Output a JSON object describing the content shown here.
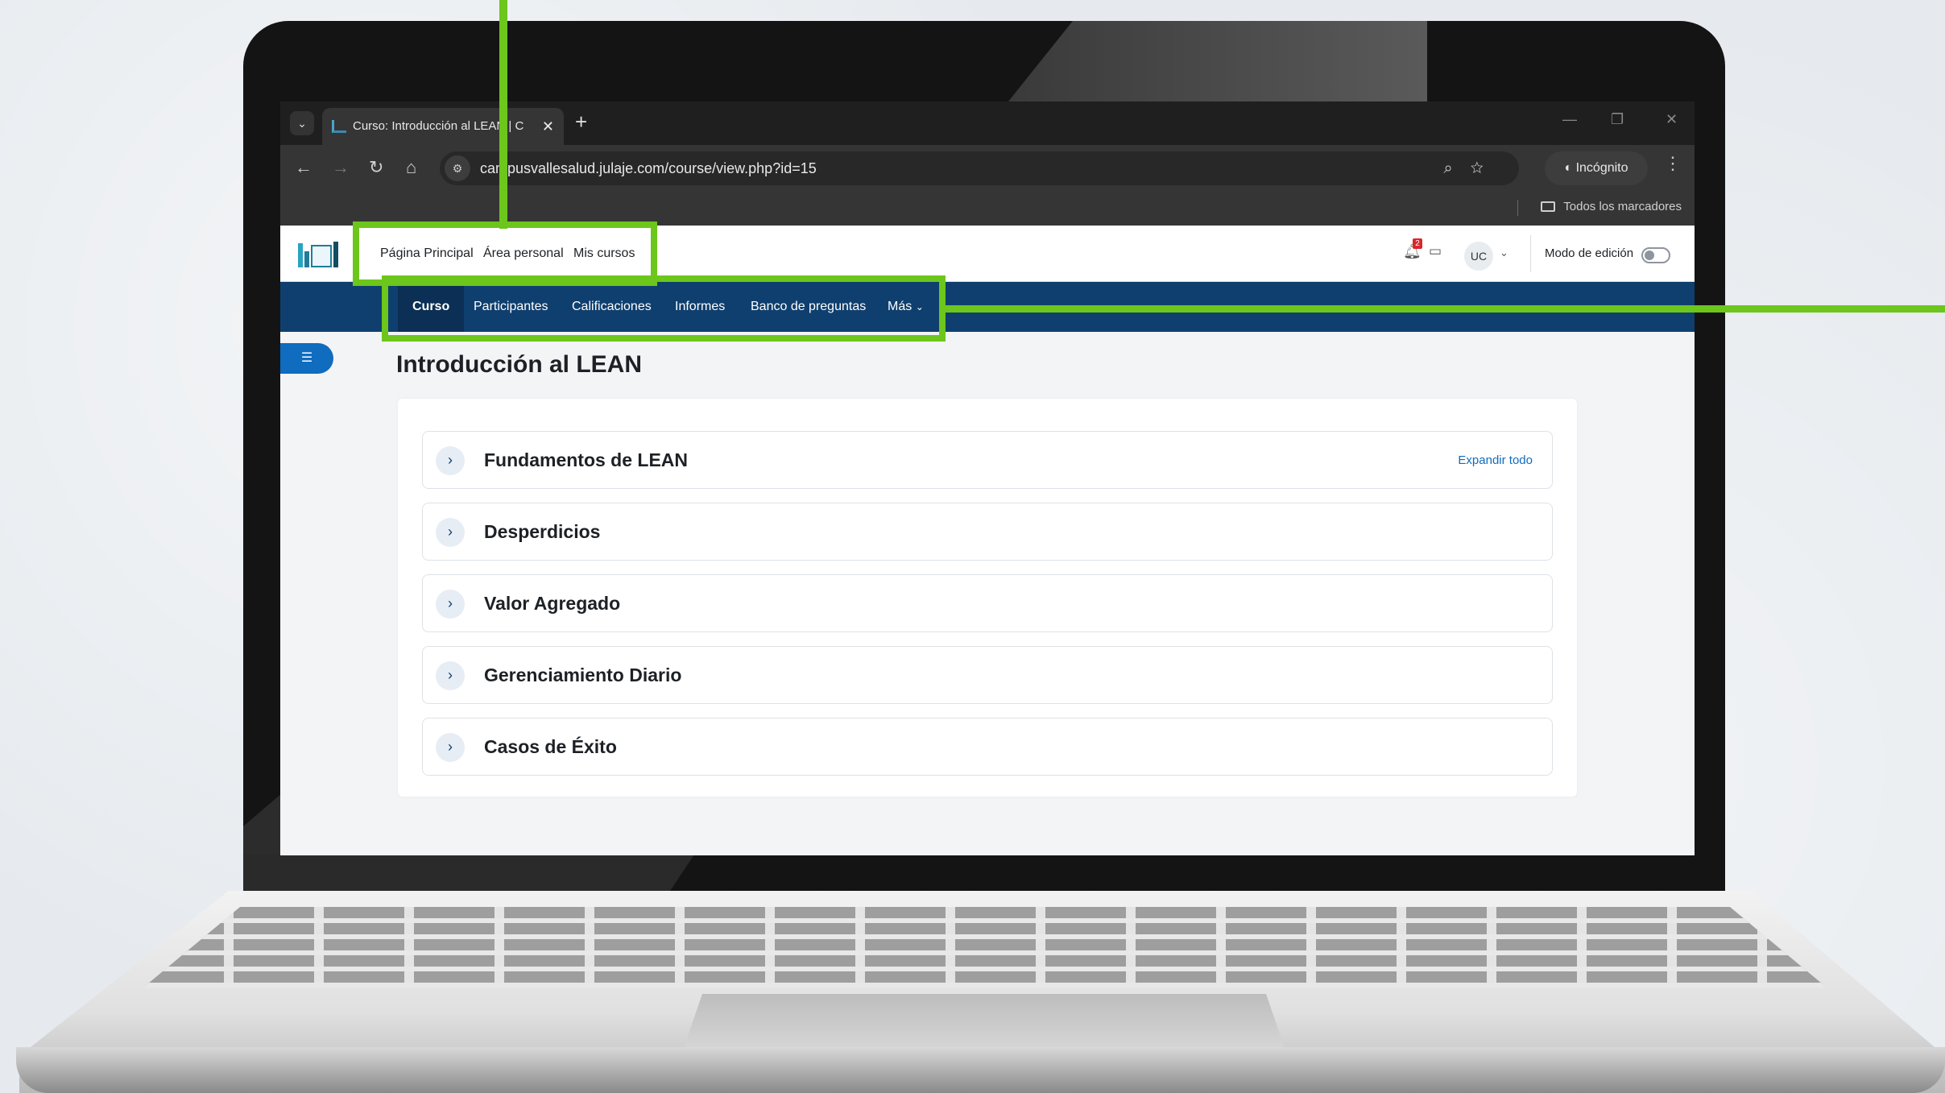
{
  "browser": {
    "tab_title": "Curso: Introducción al LEAN | C",
    "tab_close": "✕",
    "new_tab": "+",
    "url": "campusvallesalud.julaje.com/course/view.php?id=15",
    "incognito_label": "Incógnito",
    "bookmarks_label": "Todos los marcadores",
    "window_controls": [
      "—",
      "❐",
      "✕"
    ]
  },
  "top_nav": {
    "links": [
      "Página Principal",
      "Área personal",
      "Mis cursos"
    ],
    "notification_count": "2",
    "avatar_initials": "UC",
    "edit_mode_label": "Modo de edición",
    "edit_mode_on": false
  },
  "secondary_nav": {
    "items": [
      "Curso",
      "Participantes",
      "Calificaciones",
      "Informes",
      "Banco de preguntas",
      "Más"
    ],
    "active": "Curso"
  },
  "course": {
    "title": "Introducción al LEAN",
    "expand_all": "Expandir todo",
    "sections": [
      {
        "title": "Fundamentos de LEAN"
      },
      {
        "title": "Desperdicios"
      },
      {
        "title": "Valor Agregado"
      },
      {
        "title": "Gerenciamiento Diario"
      },
      {
        "title": "Casos de Éxito"
      }
    ]
  },
  "colors": {
    "highlight": "#6cc61b",
    "secondary_nav_bg": "#0f3f6e",
    "accent": "#0f6cbf"
  },
  "icons": {
    "tab_search": "chevron-down-icon",
    "back": "arrow-left-icon",
    "forward": "arrow-right-icon",
    "reload": "reload-icon",
    "home": "home-icon",
    "site_settings": "tune-icon",
    "zoom": "zoom-icon",
    "bookmark": "star-icon",
    "menu": "more-vertical-icon",
    "notifications": "bell-icon",
    "messages": "chat-icon",
    "drawer": "list-icon",
    "section_expand": "chevron-right-icon"
  }
}
